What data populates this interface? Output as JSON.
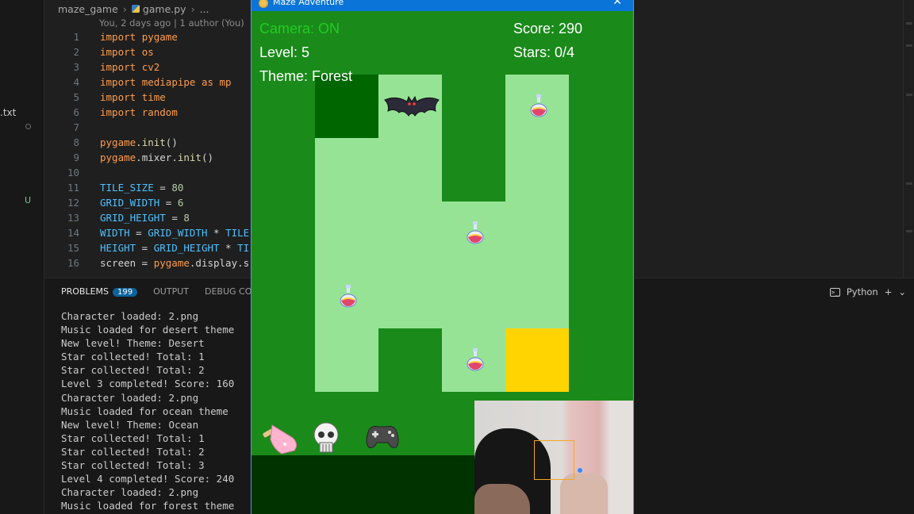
{
  "sidebar": {
    "file_label": ".txt",
    "git_status": "U"
  },
  "editor": {
    "breadcrumb": {
      "folder": "maze_game",
      "file": "game.py",
      "more": "..."
    },
    "blame": "You, 2 days ago | 1 author (You)",
    "lines": [
      {
        "n": "1",
        "parts": [
          [
            "kw",
            "import "
          ],
          [
            "kw",
            "pygame"
          ]
        ]
      },
      {
        "n": "2",
        "parts": [
          [
            "kw",
            "import "
          ],
          [
            "kw",
            "os"
          ]
        ]
      },
      {
        "n": "3",
        "parts": [
          [
            "kw",
            "import "
          ],
          [
            "kw",
            "cv2"
          ]
        ]
      },
      {
        "n": "4",
        "parts": [
          [
            "kw",
            "import "
          ],
          [
            "kw",
            "mediapipe "
          ],
          [
            "kw",
            "as "
          ],
          [
            "kw",
            "mp"
          ]
        ]
      },
      {
        "n": "5",
        "parts": [
          [
            "kw",
            "import "
          ],
          [
            "kw",
            "time"
          ]
        ]
      },
      {
        "n": "6",
        "parts": [
          [
            "kw",
            "import "
          ],
          [
            "kw",
            "random"
          ]
        ]
      },
      {
        "n": "7",
        "parts": []
      },
      {
        "n": "8",
        "parts": [
          [
            "kw",
            "pygame"
          ],
          [
            "tx",
            "."
          ],
          [
            "fn",
            "init"
          ],
          [
            "tx",
            "()"
          ]
        ]
      },
      {
        "n": "9",
        "parts": [
          [
            "kw",
            "pygame"
          ],
          [
            "tx",
            "."
          ],
          [
            "mod",
            "mixer"
          ],
          [
            "tx",
            "."
          ],
          [
            "fn",
            "init"
          ],
          [
            "tx",
            "()"
          ]
        ]
      },
      {
        "n": "10",
        "parts": []
      },
      {
        "n": "11",
        "parts": [
          [
            "var",
            "TILE_SIZE"
          ],
          [
            "tx",
            " = "
          ],
          [
            "num",
            "80"
          ]
        ]
      },
      {
        "n": "12",
        "parts": [
          [
            "var",
            "GRID_WIDTH"
          ],
          [
            "tx",
            " = "
          ],
          [
            "num",
            "6"
          ]
        ]
      },
      {
        "n": "13",
        "parts": [
          [
            "var",
            "GRID_HEIGHT"
          ],
          [
            "tx",
            " = "
          ],
          [
            "num",
            "8"
          ]
        ]
      },
      {
        "n": "14",
        "parts": [
          [
            "var",
            "WIDTH"
          ],
          [
            "tx",
            " = "
          ],
          [
            "var",
            "GRID_WIDTH"
          ],
          [
            "tx",
            " * "
          ],
          [
            "var",
            "TILE"
          ]
        ]
      },
      {
        "n": "15",
        "parts": [
          [
            "var",
            "HEIGHT"
          ],
          [
            "tx",
            " = "
          ],
          [
            "var",
            "GRID_HEIGHT"
          ],
          [
            "tx",
            " * "
          ],
          [
            "var",
            "TI"
          ]
        ]
      },
      {
        "n": "16",
        "parts": [
          [
            "tx",
            "screen = "
          ],
          [
            "kw",
            "pygame"
          ],
          [
            "tx",
            ".display.s"
          ]
        ]
      }
    ]
  },
  "panel": {
    "tabs": {
      "problems": "PROBLEMS",
      "problems_count": "199",
      "output": "OUTPUT",
      "debug": "DEBUG CONS"
    },
    "shell": "Python",
    "terminal_lines": [
      "Character loaded: 2.png",
      "Music loaded for desert theme",
      "New level! Theme: Desert",
      "Star collected! Total: 1",
      "Star collected! Total: 2",
      "Level 3 completed! Score: 160",
      "Character loaded: 2.png",
      "Music loaded for ocean theme",
      "New level! Theme: Ocean",
      "Star collected! Total: 1",
      "Star collected! Total: 2",
      "Star collected! Total: 3",
      "Level 4 completed! Score: 240",
      "Character loaded: 2.png",
      "Music loaded for forest theme"
    ]
  },
  "game": {
    "window_title": "Maze Adventure",
    "camera": "Camera: ON",
    "level": "Level: 5",
    "theme": "Theme: Forest",
    "score": "Score: 290",
    "stars": "Stars: 0/4",
    "player_sprite": "bat-icon",
    "collectible": "potion-icon",
    "inventory": [
      "popsicle-icon",
      "skull-icon",
      "gamepad-icon"
    ],
    "colors": {
      "background": "#1a8a1a",
      "path": "#96e396",
      "visited": "#006600",
      "goal": "#ffd400",
      "camera_text": "#22cc22"
    }
  }
}
